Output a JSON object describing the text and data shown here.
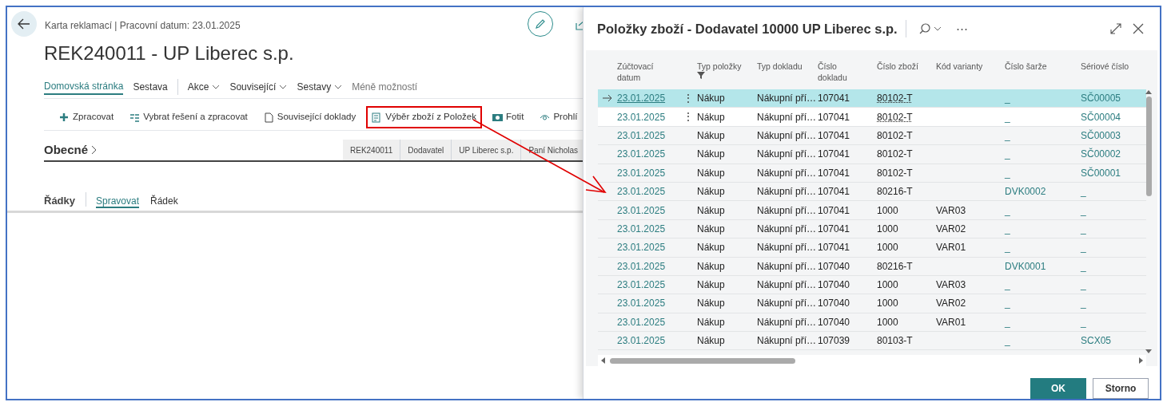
{
  "page": {
    "breadcrumb": "Karta reklamací | Pracovní datum: 23.01.2025",
    "title": "REK240011 - UP Liberec s.p.",
    "nav": [
      {
        "label": "Domovská stránka",
        "selected": true,
        "dropdown": false
      },
      {
        "label": "Sestava",
        "selected": false,
        "dropdown": false
      },
      {
        "label": "Akce",
        "selected": false,
        "dropdown": true
      },
      {
        "label": "Související",
        "selected": false,
        "dropdown": true
      },
      {
        "label": "Sestavy",
        "selected": false,
        "dropdown": true
      },
      {
        "label": "Méně možností",
        "selected": false,
        "dropdown": false,
        "muted": true
      }
    ],
    "actions": [
      {
        "label": "Zpracovat",
        "kind": "plus",
        "highlighted": false
      },
      {
        "label": "Vybrat řešení a zpracovat",
        "kind": "list",
        "highlighted": false
      },
      {
        "label": "Související doklady",
        "kind": "doc",
        "highlighted": false
      },
      {
        "label": "Výběr zboží z Položek",
        "kind": "grid",
        "highlighted": true
      },
      {
        "label": "Fotit",
        "kind": "camera",
        "highlighted": false
      },
      {
        "label": "Prohlí",
        "kind": "eye",
        "highlighted": false
      }
    ],
    "section": {
      "title": "Obecné",
      "pills": [
        "REK240011",
        "Dodavatel",
        "UP Liberec s.p.",
        "Paní Nicholas"
      ]
    },
    "lines": {
      "title": "Řádky",
      "tabs": [
        {
          "label": "Spravovat",
          "selected": true
        },
        {
          "label": "Řádek",
          "selected": false
        }
      ]
    }
  },
  "dialog": {
    "title": "Položky zboží - Dodavatel 10000 UP Liberec s.p.",
    "more": "⋯",
    "columns": [
      "Zúčtovací datum",
      "Typ položky",
      "Typ dokladu",
      "Číslo dokladu",
      "Číslo zboží",
      "Kód varianty",
      "Číslo šarže",
      "Sériové číslo"
    ],
    "rows": [
      {
        "selected": true,
        "menu": "⋮",
        "cells": [
          "23.01.2025",
          "Nákup",
          "Nákupní pří…",
          "107041",
          "80102-T",
          "",
          "_",
          "SČ00005"
        ]
      },
      {
        "selected": false,
        "menu": "⋮",
        "cells": [
          "23.01.2025",
          "Nákup",
          "Nákupní pří…",
          "107041",
          "80102-T",
          "",
          "_",
          "SČ00004"
        ]
      },
      {
        "selected": false,
        "cells": [
          "23.01.2025",
          "Nákup",
          "Nákupní pří…",
          "107041",
          "80102-T",
          "",
          "_",
          "SČ00003"
        ]
      },
      {
        "selected": false,
        "cells": [
          "23.01.2025",
          "Nákup",
          "Nákupní pří…",
          "107041",
          "80102-T",
          "",
          "_",
          "SČ00002"
        ]
      },
      {
        "selected": false,
        "cells": [
          "23.01.2025",
          "Nákup",
          "Nákupní pří…",
          "107041",
          "80102-T",
          "",
          "_",
          "SČ00001"
        ]
      },
      {
        "selected": false,
        "cells": [
          "23.01.2025",
          "Nákup",
          "Nákupní pří…",
          "107041",
          "80216-T",
          "",
          "DVK0002",
          "_"
        ]
      },
      {
        "selected": false,
        "cells": [
          "23.01.2025",
          "Nákup",
          "Nákupní pří…",
          "107041",
          "1000",
          "VAR03",
          "_",
          "_"
        ]
      },
      {
        "selected": false,
        "cells": [
          "23.01.2025",
          "Nákup",
          "Nákupní pří…",
          "107041",
          "1000",
          "VAR02",
          "_",
          "_"
        ]
      },
      {
        "selected": false,
        "cells": [
          "23.01.2025",
          "Nákup",
          "Nákupní pří…",
          "107041",
          "1000",
          "VAR01",
          "_",
          "_"
        ]
      },
      {
        "selected": false,
        "cells": [
          "23.01.2025",
          "Nákup",
          "Nákupní pří…",
          "107040",
          "80216-T",
          "",
          "DVK0001",
          "_"
        ]
      },
      {
        "selected": false,
        "cells": [
          "23.01.2025",
          "Nákup",
          "Nákupní pří…",
          "107040",
          "1000",
          "VAR03",
          "_",
          "_"
        ]
      },
      {
        "selected": false,
        "cells": [
          "23.01.2025",
          "Nákup",
          "Nákupní pří…",
          "107040",
          "1000",
          "VAR02",
          "_",
          "_"
        ]
      },
      {
        "selected": false,
        "cells": [
          "23.01.2025",
          "Nákup",
          "Nákupní pří…",
          "107040",
          "1000",
          "VAR01",
          "_",
          "_"
        ]
      },
      {
        "selected": false,
        "cells": [
          "23.01.2025",
          "Nákup",
          "Nákupní pří…",
          "107039",
          "80103-T",
          "",
          "_",
          "SCX05"
        ]
      }
    ],
    "buttons": [
      {
        "label": "OK",
        "primary": true
      },
      {
        "label": "Storno",
        "primary": false
      }
    ]
  }
}
